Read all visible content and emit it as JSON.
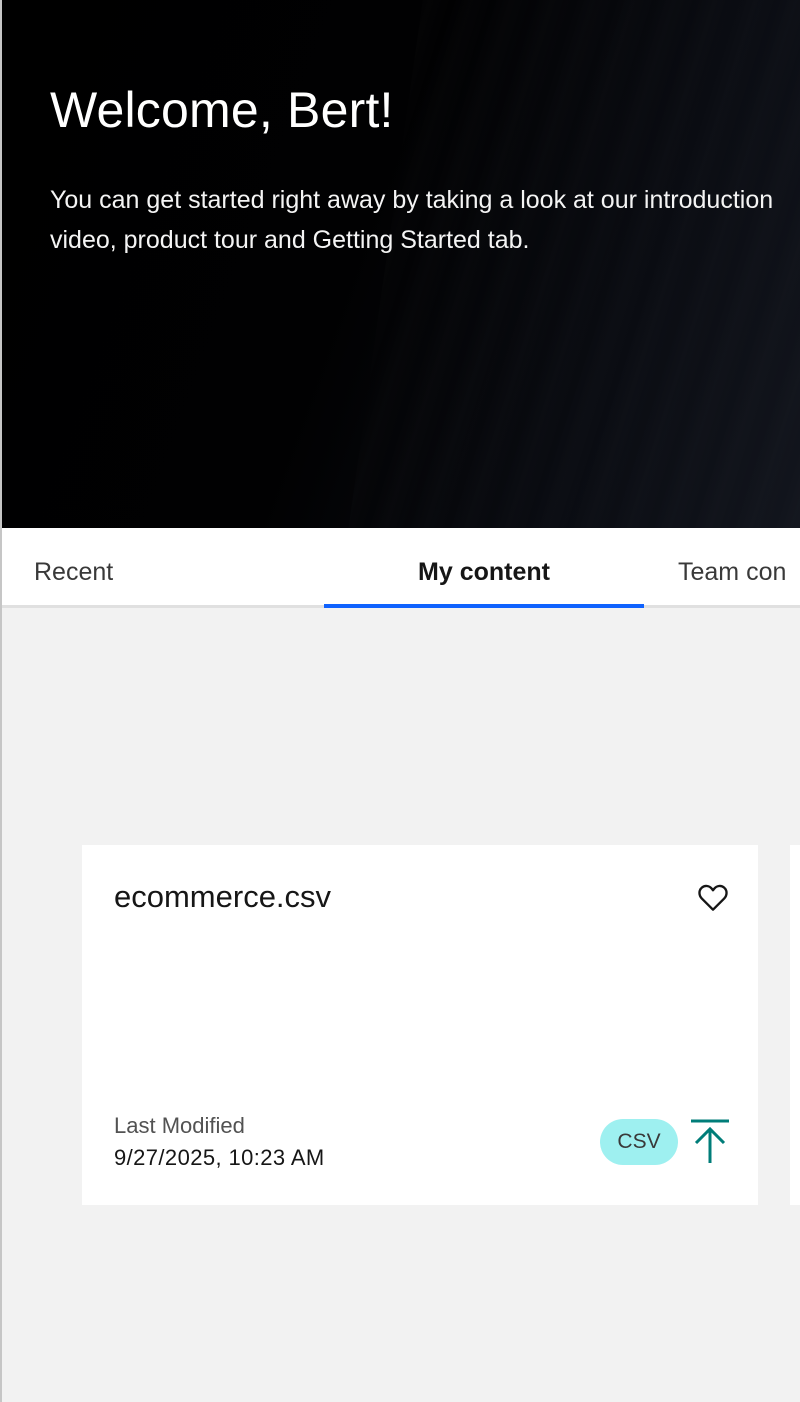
{
  "hero": {
    "title": "Welcome, Bert!",
    "subtitle": "You can get started right away by taking a look at our introduction video, product tour and Getting Started tab."
  },
  "tabs": [
    {
      "label": "Recent",
      "selected": false
    },
    {
      "label": "My content",
      "selected": true
    },
    {
      "label": "Team con",
      "selected": false
    }
  ],
  "card": {
    "title": "ecommerce.csv",
    "last_modified_label": "Last Modified",
    "last_modified_value": "9/27/2025, 10:23 AM",
    "type_tag": "CSV",
    "favorite_icon": "heart-outline-icon",
    "type_icon": "upload-icon"
  },
  "colors": {
    "accent": "#0f62fe",
    "tag_bg": "#9ef0f0",
    "icon_teal": "#007d79"
  }
}
